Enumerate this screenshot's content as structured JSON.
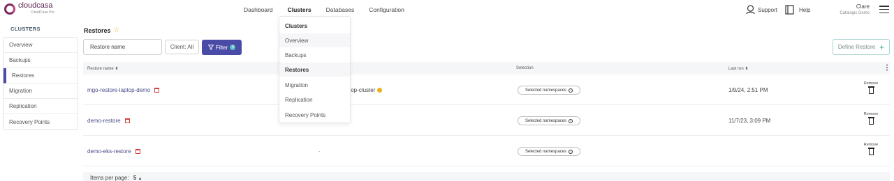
{
  "brand": {
    "name": "cloudcasa",
    "sub": "CloudCasa Pro"
  },
  "nav": [
    "Dashboard",
    "Clusters",
    "Databases",
    "Configuration"
  ],
  "nav_active": "Clusters",
  "topright": {
    "support": "Support",
    "help": "Help",
    "user_name": "Clare",
    "user_org": "Catalogic Demo"
  },
  "sidebar": {
    "title": "CLUSTERS",
    "items": [
      "Overview",
      "Backups",
      "Restores",
      "Migration",
      "Replication",
      "Recovery Points"
    ],
    "active": "Restores"
  },
  "page": {
    "title": "Restores"
  },
  "toolbar": {
    "search_placeholder": "Restore name",
    "client": "Client: All",
    "filter": "Filter",
    "filter_count": "0",
    "define": "Define Restore"
  },
  "table": {
    "headers": {
      "name": "Restore name ⬍",
      "selection": "Selection",
      "last_run": "Last run ⬍",
      "menu": "⋮"
    },
    "rows": [
      {
        "name": "mgo-restore-laptop-demo",
        "cluster": "top-cluster",
        "selection": "Selected namespaces",
        "last_run": "1/9/24, 2:51 PM",
        "remove": "Remove"
      },
      {
        "name": "demo-restore",
        "cluster": "",
        "selection": "Selected namespaces",
        "last_run": "11/7/23, 3:09 PM",
        "remove": "Remove"
      },
      {
        "name": "demo-eks-restore",
        "cluster": "-",
        "selection": "Selected namespaces",
        "last_run": "",
        "remove": "Remove"
      }
    ]
  },
  "footer": {
    "label": "Items per page:",
    "value": "5"
  },
  "dropdown": {
    "header": "Clusters",
    "items": [
      "Overview",
      "Backups",
      "Restores",
      "Migration",
      "Replication",
      "Recovery Points"
    ],
    "selected": "Restores"
  }
}
